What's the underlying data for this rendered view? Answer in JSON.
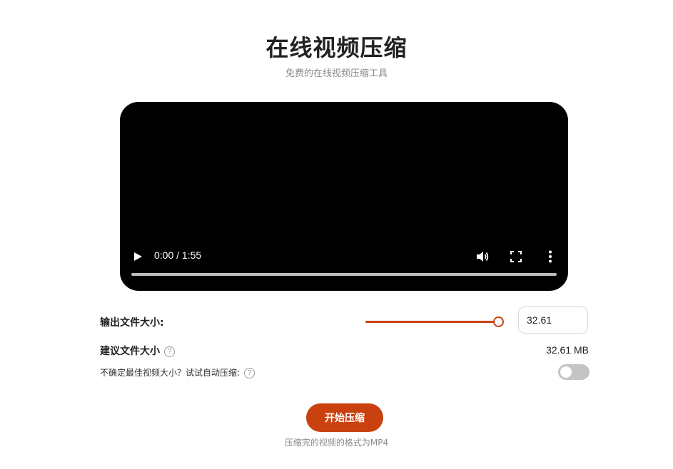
{
  "header": {
    "title": "在线视频压缩",
    "subtitle": "免费的在线视频压缩工具"
  },
  "video_player": {
    "time": "0:00 / 1:55",
    "controls": {
      "play_icon": "play-icon",
      "volume_icon": "volume-icon",
      "fullscreen_icon": "fullscreen-icon",
      "more_icon": "more-vertical-icon"
    },
    "progress": 0
  },
  "output_size": {
    "label": "输出文件大小:",
    "slider_fraction": 1.0,
    "value": "32.61"
  },
  "suggested_size": {
    "label": "建议文件大小",
    "help": "?",
    "value": "32.61 MB"
  },
  "auto_compress": {
    "label": "不确定最佳视频大小？试试自动压缩:",
    "help": "?",
    "enabled": false
  },
  "actions": {
    "start_label": "开始压缩",
    "format_note": "压缩完的视频的格式为MP4"
  },
  "colors": {
    "accent": "#c8410f",
    "toggle_off": "#c4c4c4",
    "video_bg": "#000000"
  }
}
